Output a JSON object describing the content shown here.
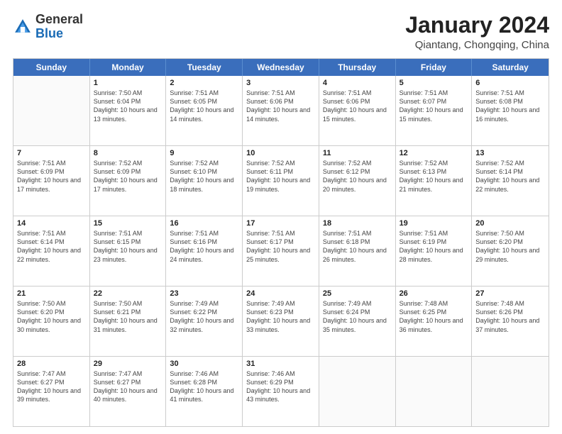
{
  "logo": {
    "general": "General",
    "blue": "Blue"
  },
  "header": {
    "month": "January 2024",
    "location": "Qiantang, Chongqing, China"
  },
  "weekdays": [
    "Sunday",
    "Monday",
    "Tuesday",
    "Wednesday",
    "Thursday",
    "Friday",
    "Saturday"
  ],
  "weeks": [
    [
      {
        "day": "",
        "sunrise": "",
        "sunset": "",
        "daylight": ""
      },
      {
        "day": "1",
        "sunrise": "Sunrise: 7:50 AM",
        "sunset": "Sunset: 6:04 PM",
        "daylight": "Daylight: 10 hours and 13 minutes."
      },
      {
        "day": "2",
        "sunrise": "Sunrise: 7:51 AM",
        "sunset": "Sunset: 6:05 PM",
        "daylight": "Daylight: 10 hours and 14 minutes."
      },
      {
        "day": "3",
        "sunrise": "Sunrise: 7:51 AM",
        "sunset": "Sunset: 6:06 PM",
        "daylight": "Daylight: 10 hours and 14 minutes."
      },
      {
        "day": "4",
        "sunrise": "Sunrise: 7:51 AM",
        "sunset": "Sunset: 6:06 PM",
        "daylight": "Daylight: 10 hours and 15 minutes."
      },
      {
        "day": "5",
        "sunrise": "Sunrise: 7:51 AM",
        "sunset": "Sunset: 6:07 PM",
        "daylight": "Daylight: 10 hours and 15 minutes."
      },
      {
        "day": "6",
        "sunrise": "Sunrise: 7:51 AM",
        "sunset": "Sunset: 6:08 PM",
        "daylight": "Daylight: 10 hours and 16 minutes."
      }
    ],
    [
      {
        "day": "7",
        "sunrise": "Sunrise: 7:51 AM",
        "sunset": "Sunset: 6:09 PM",
        "daylight": "Daylight: 10 hours and 17 minutes."
      },
      {
        "day": "8",
        "sunrise": "Sunrise: 7:52 AM",
        "sunset": "Sunset: 6:09 PM",
        "daylight": "Daylight: 10 hours and 17 minutes."
      },
      {
        "day": "9",
        "sunrise": "Sunrise: 7:52 AM",
        "sunset": "Sunset: 6:10 PM",
        "daylight": "Daylight: 10 hours and 18 minutes."
      },
      {
        "day": "10",
        "sunrise": "Sunrise: 7:52 AM",
        "sunset": "Sunset: 6:11 PM",
        "daylight": "Daylight: 10 hours and 19 minutes."
      },
      {
        "day": "11",
        "sunrise": "Sunrise: 7:52 AM",
        "sunset": "Sunset: 6:12 PM",
        "daylight": "Daylight: 10 hours and 20 minutes."
      },
      {
        "day": "12",
        "sunrise": "Sunrise: 7:52 AM",
        "sunset": "Sunset: 6:13 PM",
        "daylight": "Daylight: 10 hours and 21 minutes."
      },
      {
        "day": "13",
        "sunrise": "Sunrise: 7:52 AM",
        "sunset": "Sunset: 6:14 PM",
        "daylight": "Daylight: 10 hours and 22 minutes."
      }
    ],
    [
      {
        "day": "14",
        "sunrise": "Sunrise: 7:51 AM",
        "sunset": "Sunset: 6:14 PM",
        "daylight": "Daylight: 10 hours and 22 minutes."
      },
      {
        "day": "15",
        "sunrise": "Sunrise: 7:51 AM",
        "sunset": "Sunset: 6:15 PM",
        "daylight": "Daylight: 10 hours and 23 minutes."
      },
      {
        "day": "16",
        "sunrise": "Sunrise: 7:51 AM",
        "sunset": "Sunset: 6:16 PM",
        "daylight": "Daylight: 10 hours and 24 minutes."
      },
      {
        "day": "17",
        "sunrise": "Sunrise: 7:51 AM",
        "sunset": "Sunset: 6:17 PM",
        "daylight": "Daylight: 10 hours and 25 minutes."
      },
      {
        "day": "18",
        "sunrise": "Sunrise: 7:51 AM",
        "sunset": "Sunset: 6:18 PM",
        "daylight": "Daylight: 10 hours and 26 minutes."
      },
      {
        "day": "19",
        "sunrise": "Sunrise: 7:51 AM",
        "sunset": "Sunset: 6:19 PM",
        "daylight": "Daylight: 10 hours and 28 minutes."
      },
      {
        "day": "20",
        "sunrise": "Sunrise: 7:50 AM",
        "sunset": "Sunset: 6:20 PM",
        "daylight": "Daylight: 10 hours and 29 minutes."
      }
    ],
    [
      {
        "day": "21",
        "sunrise": "Sunrise: 7:50 AM",
        "sunset": "Sunset: 6:20 PM",
        "daylight": "Daylight: 10 hours and 30 minutes."
      },
      {
        "day": "22",
        "sunrise": "Sunrise: 7:50 AM",
        "sunset": "Sunset: 6:21 PM",
        "daylight": "Daylight: 10 hours and 31 minutes."
      },
      {
        "day": "23",
        "sunrise": "Sunrise: 7:49 AM",
        "sunset": "Sunset: 6:22 PM",
        "daylight": "Daylight: 10 hours and 32 minutes."
      },
      {
        "day": "24",
        "sunrise": "Sunrise: 7:49 AM",
        "sunset": "Sunset: 6:23 PM",
        "daylight": "Daylight: 10 hours and 33 minutes."
      },
      {
        "day": "25",
        "sunrise": "Sunrise: 7:49 AM",
        "sunset": "Sunset: 6:24 PM",
        "daylight": "Daylight: 10 hours and 35 minutes."
      },
      {
        "day": "26",
        "sunrise": "Sunrise: 7:48 AM",
        "sunset": "Sunset: 6:25 PM",
        "daylight": "Daylight: 10 hours and 36 minutes."
      },
      {
        "day": "27",
        "sunrise": "Sunrise: 7:48 AM",
        "sunset": "Sunset: 6:26 PM",
        "daylight": "Daylight: 10 hours and 37 minutes."
      }
    ],
    [
      {
        "day": "28",
        "sunrise": "Sunrise: 7:47 AM",
        "sunset": "Sunset: 6:27 PM",
        "daylight": "Daylight: 10 hours and 39 minutes."
      },
      {
        "day": "29",
        "sunrise": "Sunrise: 7:47 AM",
        "sunset": "Sunset: 6:27 PM",
        "daylight": "Daylight: 10 hours and 40 minutes."
      },
      {
        "day": "30",
        "sunrise": "Sunrise: 7:46 AM",
        "sunset": "Sunset: 6:28 PM",
        "daylight": "Daylight: 10 hours and 41 minutes."
      },
      {
        "day": "31",
        "sunrise": "Sunrise: 7:46 AM",
        "sunset": "Sunset: 6:29 PM",
        "daylight": "Daylight: 10 hours and 43 minutes."
      },
      {
        "day": "",
        "sunrise": "",
        "sunset": "",
        "daylight": ""
      },
      {
        "day": "",
        "sunrise": "",
        "sunset": "",
        "daylight": ""
      },
      {
        "day": "",
        "sunrise": "",
        "sunset": "",
        "daylight": ""
      }
    ]
  ]
}
